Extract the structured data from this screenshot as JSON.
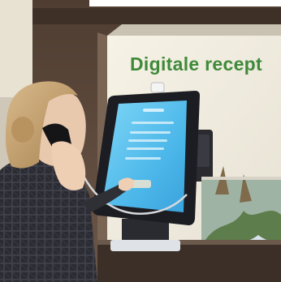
{
  "photo": {
    "sign": {
      "text": "Digitale recept"
    },
    "colors": {
      "sign_green": "#3f8a3a",
      "wall": "#f1ede2",
      "cabinet_wood": "#5d4a3d",
      "screen_glow": "#57c3ee",
      "kiosk_frame": "#1c1d22",
      "sweater": "#2c2c32"
    }
  }
}
